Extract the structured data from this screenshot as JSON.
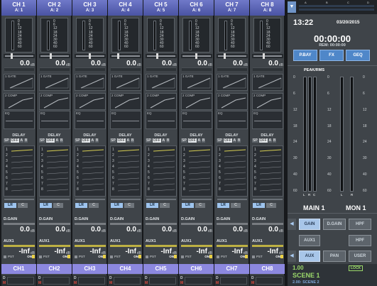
{
  "channels": [
    {
      "id": "CH 1",
      "assign": "A: 1",
      "name": "CH1"
    },
    {
      "id": "CH 2",
      "assign": "A: 2",
      "name": "CH2"
    },
    {
      "id": "CH 3",
      "assign": "A: 3",
      "name": "CH3"
    },
    {
      "id": "CH 4",
      "assign": "A: 4",
      "name": "CH4"
    },
    {
      "id": "CH 5",
      "assign": "A: 5",
      "name": "CH5"
    },
    {
      "id": "CH 6",
      "assign": "A: 6",
      "name": "CH6"
    },
    {
      "id": "CH 7",
      "assign": "A: 7",
      "name": "CH7"
    },
    {
      "id": "CH 8",
      "assign": "A: 8",
      "name": "CH8"
    }
  ],
  "strip": {
    "meter_scale": [
      "0",
      "6",
      "12",
      "18",
      "24",
      "30",
      "40",
      "60"
    ],
    "fader_value": "0.0",
    "fader_unit": "dB",
    "gate_label": "1 GATE",
    "comp_label": "2 COMP",
    "eq_label": "EQ",
    "delay_label": "DELAY",
    "delay_buttons": [
      "SP",
      "OFF",
      "A",
      "B"
    ],
    "delay_rows": [
      "1",
      "2",
      "3",
      "4",
      "5",
      "6",
      "7",
      "8"
    ],
    "lr_label": "LR",
    "c_label": "C",
    "dgain_label": "D.GAIN",
    "dgain_value": "0.0",
    "aux_label": "AUX1",
    "aux_value": "-Inf",
    "aux_unit": "dB",
    "pst_label": "PST",
    "on_label": "ON",
    "d_label": "D",
    "m_label": "M"
  },
  "right": {
    "top_meter_labels": [
      "A",
      "B",
      "C",
      "D"
    ],
    "time": "13:22",
    "date": "03/20/2015",
    "timer": "00:00:00",
    "rem": "REM: 00:00:00",
    "buttons_top": [
      "P.BAY",
      "FX",
      "GEQ"
    ],
    "peak_label": "PEAK/RMS",
    "peak_scale": [
      "0",
      "6",
      "12",
      "18",
      "24",
      "30",
      "40",
      "60"
    ],
    "meter_channels": [
      "L",
      "R",
      "C"
    ],
    "meter_channels_2": [
      "L",
      "R"
    ],
    "main_label": "MAIN 1",
    "mon_label": "MON 1",
    "row1": [
      "GAIN",
      "D.GAIN",
      "HPF"
    ],
    "row2": [
      "AUX1",
      "HPF"
    ],
    "row3": [
      "AUX",
      "PAN",
      "USER"
    ],
    "scene_number": "1.00",
    "scene_name": "SCENE 1",
    "lock": "LOCK",
    "scene_next": "2.00: SCENE 2"
  },
  "colors": {
    "header": "#5e67b8",
    "name_bar": "#8c88df",
    "accent_blue": "#4f87c9",
    "scene_green": "#9bd86a",
    "delay_line": "#d8cf52"
  }
}
